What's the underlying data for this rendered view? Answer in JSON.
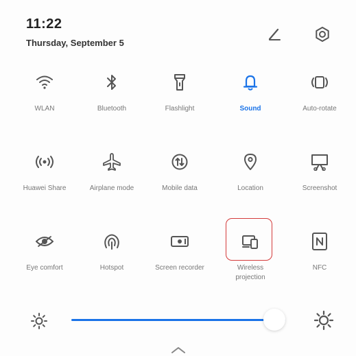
{
  "status": {
    "time": "11:22",
    "date": "Thursday, September 5"
  },
  "header": {
    "edit_icon": "pencil-icon",
    "settings_icon": "gear-icon"
  },
  "tiles": [
    {
      "label": "WLAN",
      "icon": "wifi-icon",
      "active": false
    },
    {
      "label": "Bluetooth",
      "icon": "bluetooth-icon",
      "active": false
    },
    {
      "label": "Flashlight",
      "icon": "flashlight-icon",
      "active": false
    },
    {
      "label": "Sound",
      "icon": "bell-icon",
      "active": true
    },
    {
      "label": "Auto-rotate",
      "icon": "rotate-icon",
      "active": false
    },
    {
      "label": "Huawei Share",
      "icon": "share-waves-icon",
      "active": false
    },
    {
      "label": "Airplane mode",
      "icon": "airplane-icon",
      "active": false
    },
    {
      "label": "Mobile data",
      "icon": "mobile-data-icon",
      "active": false
    },
    {
      "label": "Location",
      "icon": "location-pin-icon",
      "active": false
    },
    {
      "label": "Screenshot",
      "icon": "screenshot-icon",
      "active": false
    },
    {
      "label": "Eye comfort",
      "icon": "eye-icon",
      "active": false
    },
    {
      "label": "Hotspot",
      "icon": "hotspot-icon",
      "active": false
    },
    {
      "label": "Screen recorder",
      "icon": "screen-recorder-icon",
      "active": false
    },
    {
      "label": "Wireless projection",
      "icon": "wireless-projection-icon",
      "active": false
    },
    {
      "label": "NFC",
      "icon": "nfc-icon",
      "active": false
    }
  ],
  "brightness": {
    "level": 0.95,
    "low_icon": "sun-small-icon",
    "high_icon": "sun-large-icon"
  },
  "colors": {
    "accent": "#1a73e8",
    "highlight": "#d43a3a",
    "icon": "#555555"
  }
}
